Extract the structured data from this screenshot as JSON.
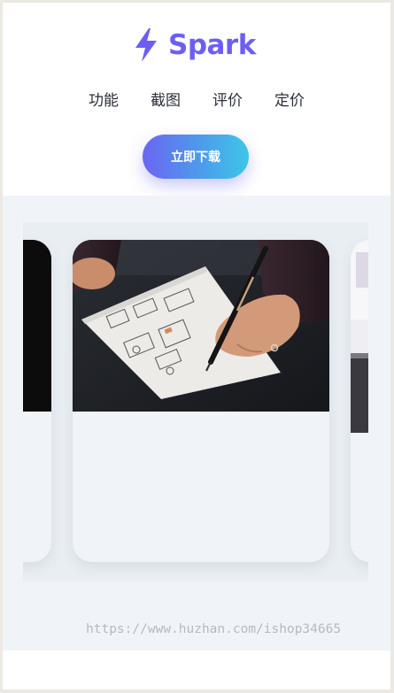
{
  "brand": {
    "name": "Spark",
    "logo_icon": "lightning-bolt-icon",
    "color": "#6c5ef5"
  },
  "nav": {
    "items": [
      {
        "label": "功能"
      },
      {
        "label": "截图"
      },
      {
        "label": "评价"
      },
      {
        "label": "定价"
      }
    ]
  },
  "cta": {
    "download_label": "立即下载",
    "gradient_start": "#6a66f2",
    "gradient_end": "#3ec6e8"
  },
  "gallery": {
    "cards": [
      {
        "image": "dark-screenshot-image"
      },
      {
        "image": "hand-sketching-wireframe-photo"
      },
      {
        "image": "app-screenshot-image"
      }
    ]
  },
  "watermark": {
    "text": "https://www.huzhan.com/ishop34665"
  }
}
